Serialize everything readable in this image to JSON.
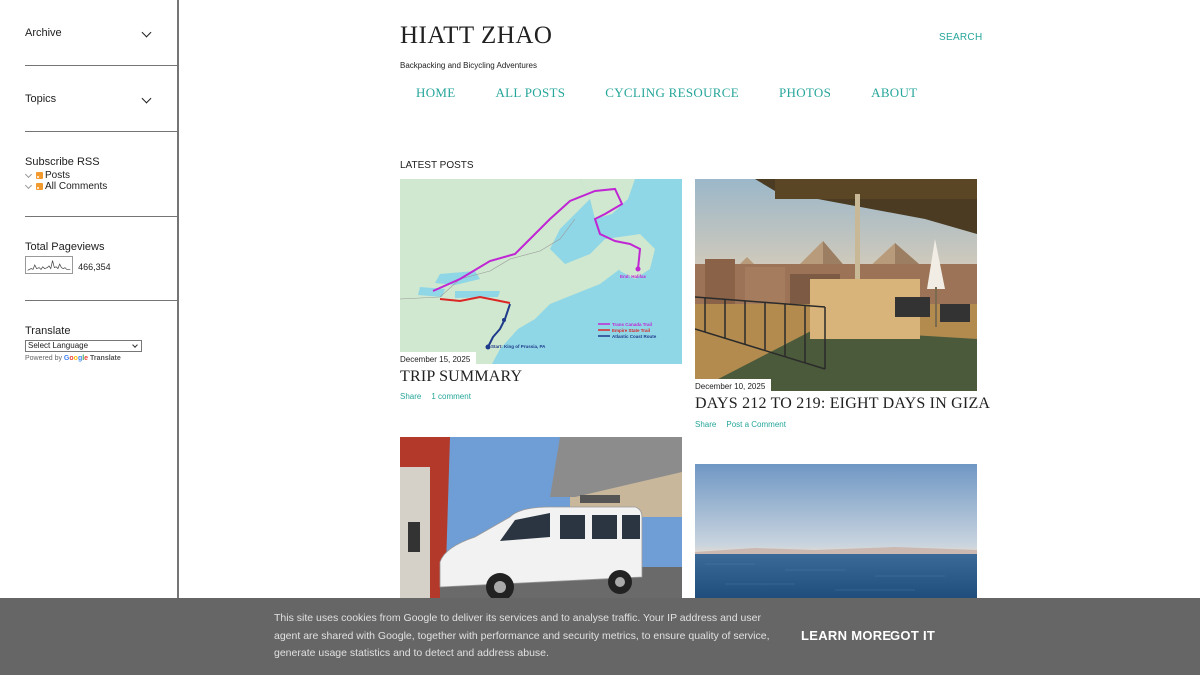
{
  "sidebar": {
    "archive_label": "Archive",
    "topics_label": "Topics",
    "rss": {
      "title": "Subscribe RSS",
      "items": [
        {
          "label": "Posts"
        },
        {
          "label": "All Comments"
        }
      ]
    },
    "pageviews": {
      "title": "Total Pageviews",
      "count": "466,354"
    },
    "translate": {
      "title": "Translate",
      "select_value": "Select Language",
      "powered_by": "Powered by",
      "google": "Google",
      "translate_link": "Translate"
    }
  },
  "header": {
    "title": "HIATT ZHAO",
    "description": "Backpacking and Bicycling Adventures",
    "search_label": "SEARCH",
    "nav": [
      {
        "label": "HOME"
      },
      {
        "label": "ALL POSTS"
      },
      {
        "label": "CYCLING RESOURCE"
      },
      {
        "label": "PHOTOS"
      },
      {
        "label": "ABOUT"
      }
    ]
  },
  "main": {
    "section_title": "LATEST POSTS",
    "posts": [
      {
        "date": "December 15, 2025",
        "title": "TRIP SUMMARY",
        "share": "Share",
        "comments": "1 comment"
      },
      {
        "date": "December 10, 2025",
        "title": "DAYS 212 TO 219: EIGHT DAYS IN GIZA",
        "share": "Share",
        "comments": "Post a Comment"
      }
    ],
    "map_legend": [
      {
        "label": "Trans Canada Trail",
        "color": "#c026d3"
      },
      {
        "label": "Empire State Trail",
        "color": "#dc2626"
      },
      {
        "label": "Atlantic Coast Route",
        "color": "#1e3a8a"
      }
    ],
    "map_labels": {
      "start": "Start: King of Prussia, PA",
      "end": "End: Halifax"
    }
  },
  "cookie": {
    "text": "This site uses cookies from Google to deliver its services and to analyse traffic. Your IP address and user agent are shared with Google, together with performance and security metrics, to ensure quality of service, generate usage statistics and to detect and address abuse.",
    "learn_more": "LEARN MORE",
    "got_it": "GOT IT"
  },
  "colors": {
    "accent": "#26a69a",
    "cookie_bg": "#666666"
  }
}
